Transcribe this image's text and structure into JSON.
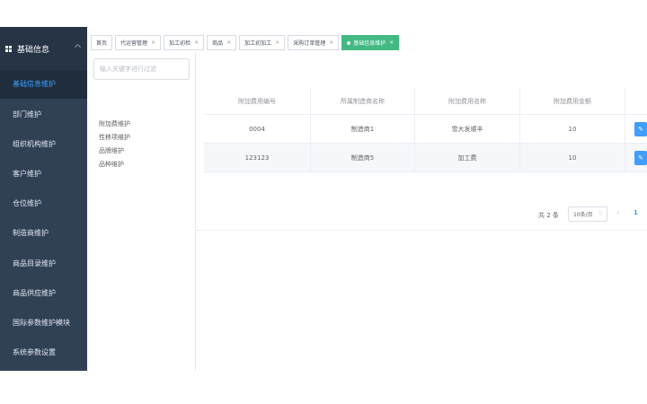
{
  "sidebar": {
    "title": "基础信息",
    "items": [
      {
        "label": "基础信息维护",
        "active": true
      },
      {
        "label": "部门维护"
      },
      {
        "label": "组织机构维护"
      },
      {
        "label": "客户维护"
      },
      {
        "label": "仓位维护"
      },
      {
        "label": "制造商维护"
      },
      {
        "label": "商品目录维护"
      },
      {
        "label": "商品供应维护"
      },
      {
        "label": "国际参数维护模块"
      },
      {
        "label": "系统参数设置"
      }
    ]
  },
  "tabs": [
    {
      "label": "首页"
    },
    {
      "label": "代运营管理"
    },
    {
      "label": "加工初检"
    },
    {
      "label": "商品"
    },
    {
      "label": "加工初加工"
    },
    {
      "label": "采购订单管理"
    },
    {
      "label": "基础信息维护",
      "active": true
    }
  ],
  "tree": {
    "search_placeholder": "输入关键字进行过滤",
    "items": [
      "附加费维护",
      "性移项维护",
      "品牌维护",
      "品种维护"
    ]
  },
  "table": {
    "headers": [
      "附加费用编号",
      "所属制造商名称",
      "附加费用名称",
      "附加费用金额"
    ],
    "rows": [
      {
        "code": "0004",
        "maker": "制造商1",
        "name": "雪大发顺丰",
        "amount": "10"
      },
      {
        "code": "123123",
        "maker": "制造商5",
        "name": "加工费",
        "amount": "10"
      }
    ]
  },
  "pagination": {
    "total": "共 2 条",
    "page_size": "10条/页",
    "current": "1"
  },
  "colors": {
    "sidebar": "#304156",
    "active_tab": "#42b983",
    "primary": "#409eff"
  }
}
